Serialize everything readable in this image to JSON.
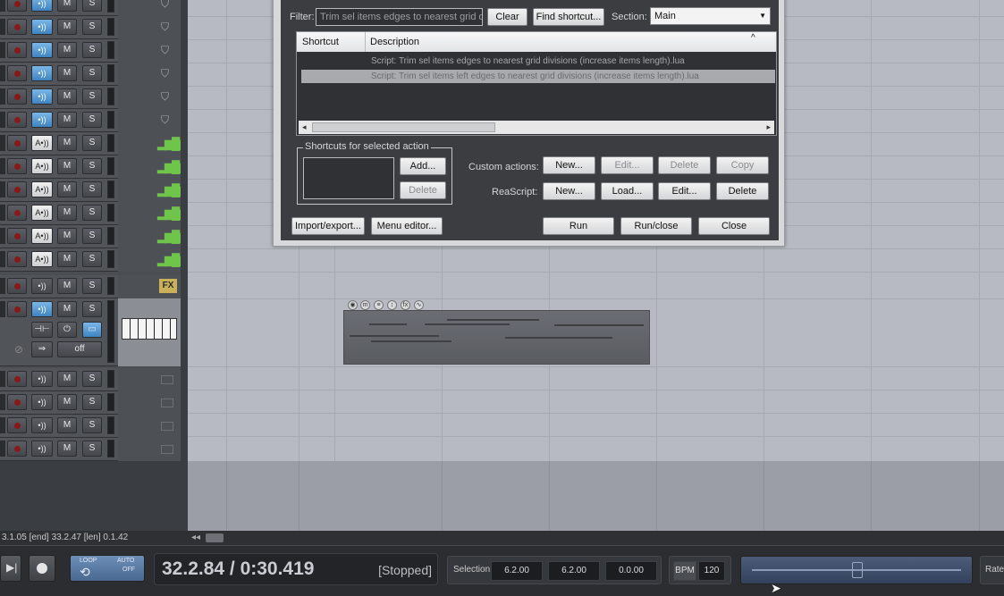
{
  "dialog": {
    "filter_label": "Filter:",
    "filter_value": "Trim sel items edges to nearest grid div",
    "clear": "Clear",
    "find_shortcut": "Find shortcut...",
    "section_label": "Section:",
    "section_value": "Main",
    "col_shortcut": "Shortcut",
    "col_description": "Description",
    "rows": [
      {
        "shortcut": "",
        "description": "Script: Trim sel items edges to nearest grid divisions (increase items length).lua"
      },
      {
        "shortcut": "",
        "description": "Script: Trim sel items left edges to nearest grid divisions (increase items length).lua"
      }
    ],
    "shortcuts_group": "Shortcuts for selected action",
    "add": "Add...",
    "delete": "Delete",
    "custom_actions_label": "Custom actions:",
    "custom_new": "New...",
    "custom_edit": "Edit...",
    "custom_delete": "Delete",
    "custom_copy": "Copy",
    "reascript_label": "ReaScript:",
    "rs_new": "New...",
    "rs_load": "Load...",
    "rs_edit": "Edit...",
    "rs_delete": "Delete",
    "import_export": "Import/export...",
    "menu_editor": "Menu editor...",
    "run": "Run",
    "run_close": "Run/close",
    "close": "Close"
  },
  "tracks": {
    "m": "M",
    "s": "S",
    "monitor": "•))",
    "auto_off": "off",
    "fx": "FX"
  },
  "status": {
    "text": "3.1.05 [end] 33.2.47 [len] 0.1.42"
  },
  "transport": {
    "loop_label": "LOOP",
    "auto_label": "AUTO",
    "auto_off": "OFF",
    "time": "32.2.84 / 0:30.419",
    "state": "[Stopped]",
    "selection_label": "Selection:",
    "sel_start": "6.2.00",
    "sel_end": "6.2.00",
    "sel_len": "0.0.00",
    "bpm_label": "BPM",
    "bpm_value": "120",
    "rate_label": "Rate"
  },
  "colors": {
    "accent": "#3f83c2",
    "arrange_bg": "#b7bac3",
    "wave_green": "#6fc44a"
  }
}
